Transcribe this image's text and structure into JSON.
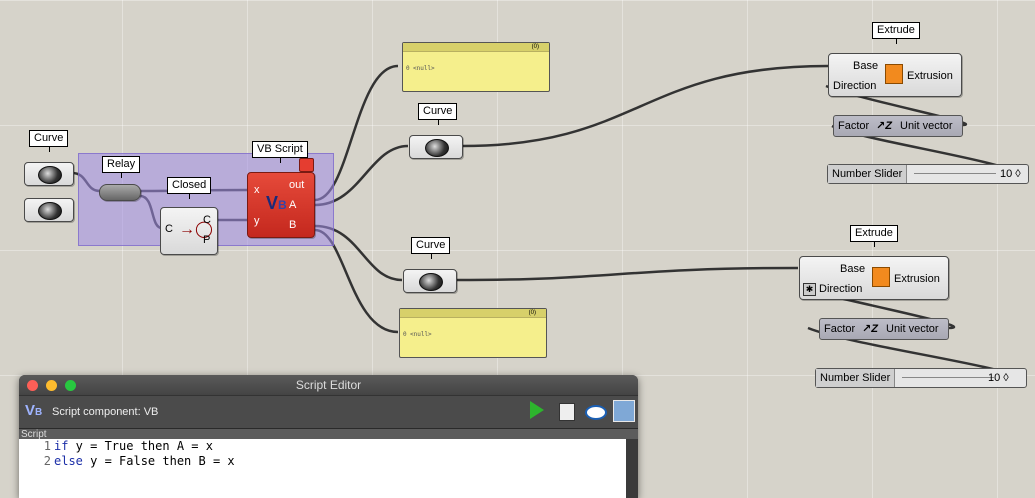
{
  "canvas": {
    "left_curve_label": "Curve",
    "relay_label": "Relay",
    "closed_label": "Closed",
    "vb_script_label": "VB Script",
    "closed_inputs": {
      "c_in": "C",
      "c_out": "C",
      "p_out": "P"
    },
    "vb_ports": {
      "x": "x",
      "y": "y",
      "out": "out",
      "a": "A",
      "b": "B"
    },
    "top_panel": {
      "count": "(0)",
      "index": "0",
      "text": "<null>"
    },
    "bottom_panel": {
      "count": "(0)",
      "index": "0",
      "text": "<null>"
    },
    "mid_curve_top_label": "Curve",
    "mid_curve_bottom_label": "Curve",
    "extrude_top": {
      "label": "Extrude",
      "base": "Base",
      "direction": "Direction",
      "output": "Extrusion"
    },
    "extrude_bottom": {
      "label": "Extrude",
      "base": "Base",
      "direction": "Direction",
      "output": "Extrusion"
    },
    "unit_vector_top": {
      "input": "Factor",
      "name": "Unit vector"
    },
    "unit_vector_bottom": {
      "input": "Factor",
      "name": "Unit vector"
    },
    "slider_top": {
      "name": "Number Slider",
      "value": "10 ◊"
    },
    "slider_bottom": {
      "name": "Number Slider",
      "value": "10 ◊"
    }
  },
  "editor": {
    "title": "Script Editor",
    "component_name": "Script component: VB",
    "section": "Script",
    "lines": [
      {
        "num": "1",
        "kw": "if",
        "rest": " y = True then A = x"
      },
      {
        "num": "2",
        "kw": "else",
        "rest": " y = False then B = x"
      }
    ]
  },
  "colors": {
    "vb_component": "#d8362a",
    "panel": "#f5ef8c",
    "group": "#a08ce6"
  }
}
